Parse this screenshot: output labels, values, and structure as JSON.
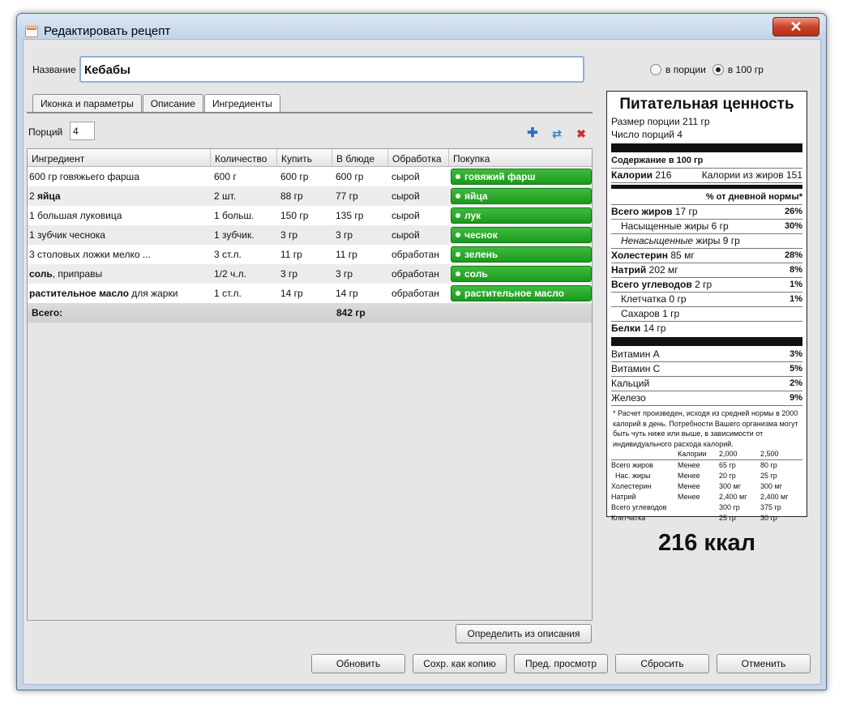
{
  "window": {
    "title": "Редактировать рецепт",
    "close_glyph": "✕"
  },
  "name_field": {
    "label": "Название",
    "value": "Кебабы"
  },
  "view_mode": {
    "options": [
      {
        "label": "в порции",
        "selected": false
      },
      {
        "label": "в 100 гр",
        "selected": true
      }
    ]
  },
  "tabs": [
    {
      "label": "Иконка и параметры",
      "active": false
    },
    {
      "label": "Описание",
      "active": false
    },
    {
      "label": "Ингредиенты",
      "active": true
    }
  ],
  "portions": {
    "label": "Порций",
    "value": "4"
  },
  "toolbar_icons": [
    "add-icon",
    "refresh-icon",
    "delete-icon"
  ],
  "ingredients_table": {
    "columns": [
      "Ингредиент",
      "Количество",
      "Купить",
      "В блюде",
      "Обработка",
      "Покупка"
    ],
    "rows": [
      {
        "ingredient_bold": "",
        "ingredient_rest": "600 гр говяжьего фарша",
        "qty": "600 г",
        "buy": "600 гр",
        "in_dish": "600 гр",
        "processing": "сырой",
        "purchase": "говяжий фарш"
      },
      {
        "ingredient_bold": "яйца",
        "ingredient_rest": "",
        "ingredient_prefix": "2 ",
        "qty": "2 шт.",
        "buy": "88 гр",
        "in_dish": "77 гр",
        "processing": "сырой",
        "purchase": "яйца"
      },
      {
        "ingredient_bold": "",
        "ingredient_rest": "1 большая луковица",
        "qty": "1 больш.",
        "buy": "150 гр",
        "in_dish": "135 гр",
        "processing": "сырой",
        "purchase": "лук"
      },
      {
        "ingredient_bold": "",
        "ingredient_rest": "1 зубчик чеснока",
        "qty": "1 зубчик.",
        "buy": "3 гр",
        "in_dish": "3 гр",
        "processing": "сырой",
        "purchase": "чеснок"
      },
      {
        "ingredient_bold": "",
        "ingredient_rest": "3 столовых ложки мелко ...",
        "qty": "3 ст.л.",
        "buy": "11 гр",
        "in_dish": "11 гр",
        "processing": "обработан",
        "purchase": "зелень"
      },
      {
        "ingredient_bold": "соль",
        "ingredient_rest": ", приправы",
        "qty": "1/2 ч.л.",
        "buy": "3 гр",
        "in_dish": "3 гр",
        "processing": "обработан",
        "purchase": "соль"
      },
      {
        "ingredient_bold": "растительное масло",
        "ingredient_rest": " для жарки",
        "qty": "1 ст.л.",
        "buy": "14 гр",
        "in_dish": "14 гр",
        "processing": "обработан",
        "purchase": "растительное масло"
      }
    ],
    "total": {
      "label": "Всего:",
      "value": "842 гр"
    }
  },
  "buttons": {
    "detect": "Определить из описания",
    "update": "Обновить",
    "save_copy": "Сохр. как копию",
    "preview": "Пред. просмотр",
    "reset": "Сбросить",
    "cancel": "Отменить"
  },
  "nutrition": {
    "title": "Питательная ценность",
    "serving_size": "Размер порции 211 гр",
    "servings": "Число порций 4",
    "content_per": "Содержание в 100 гр",
    "calories_label": "Калории",
    "calories_value": "216",
    "calories_fat": "Калории из жиров 151",
    "daily_header": "% от дневной нормы*",
    "rows": [
      {
        "bold": "Всего жиров",
        "value": " 17 гр",
        "pct": "26%",
        "indent": false,
        "italic": false
      },
      {
        "bold": "",
        "value": "Насыщенные жиры 6 гр",
        "pct": "30%",
        "indent": true,
        "italic": false
      },
      {
        "bold": "",
        "value": " жиры 9 гр",
        "italic_part": "Ненасыщенные",
        "pct": "",
        "indent": true,
        "italic": true
      },
      {
        "bold": "Холестерин",
        "value": " 85 мг",
        "pct": "28%",
        "indent": false,
        "italic": false
      },
      {
        "bold": "Натрий",
        "value": " 202 мг",
        "pct": "8%",
        "indent": false,
        "italic": false
      },
      {
        "bold": "Всего углеводов",
        "value": " 2 гр",
        "pct": "1%",
        "indent": false,
        "italic": false
      },
      {
        "bold": "",
        "value": "Клетчатка 0 гр",
        "pct": "1%",
        "indent": true,
        "italic": false
      },
      {
        "bold": "",
        "value": "Сахаров 1 гр",
        "pct": "",
        "indent": true,
        "italic": false
      },
      {
        "bold": "Белки",
        "value": " 14 гр",
        "pct": "",
        "indent": false,
        "italic": false
      }
    ],
    "vitamins": [
      {
        "label": "Витамин A",
        "pct": "3%"
      },
      {
        "label": "Витамин C",
        "pct": "5%"
      },
      {
        "label": "Кальций",
        "pct": "2%"
      },
      {
        "label": "Железо",
        "pct": "9%"
      }
    ],
    "footnote": "* Расчет произведен, исходя из средней нормы в 2000 калорий в день. Потребности Вашего организма могут быть чуть ниже или выше, в зависимости от индивидуального расхода калорий.",
    "footer_table": [
      [
        "",
        "Калории",
        "2,000",
        "2,500"
      ],
      [
        "Всего жиров",
        "Менее",
        "65 гр",
        "80 гр"
      ],
      [
        "  Нас. жиры",
        "Менее",
        "20 гр",
        "25 гр"
      ],
      [
        "Холестерин",
        "Менее",
        "300 мг",
        "300 мг"
      ],
      [
        "Натрий",
        "Менее",
        "2,400 мг",
        "2,400 мг"
      ],
      [
        "Всего углеводов",
        "",
        "300 гр",
        "375 гр"
      ],
      [
        "Клетчатка",
        "",
        "25 гр",
        "30 гр"
      ]
    ]
  },
  "kcal_total": "216 ккал"
}
